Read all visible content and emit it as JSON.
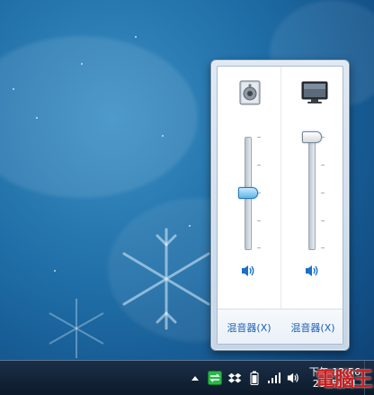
{
  "volume_mixer": {
    "devices": [
      {
        "name": "speakers",
        "icon": "speaker-device-icon",
        "level": 0.5,
        "mute_icon": "speaker-volume-icon",
        "mixer_label": "混音器(X)"
      },
      {
        "name": "monitor",
        "icon": "monitor-device-icon",
        "level": 1.0,
        "mute_icon": "speaker-volume-icon",
        "mixer_label": "混音器(X)"
      }
    ]
  },
  "taskbar": {
    "tray_icons": [
      "show-hidden-icons-arrow",
      "network-switch-icon",
      "dropbox-icon",
      "battery-icon",
      "wifi-signal-icon",
      "volume-icon"
    ],
    "time": "下午 12:56",
    "date": "2015/3/1"
  },
  "watermark": "電腦王",
  "colors": {
    "accent": "#1a5fb4",
    "thumb_blue": "#5cb6ec",
    "tray_green": "#2bb74a",
    "watermark_red": "#c81e1e"
  }
}
